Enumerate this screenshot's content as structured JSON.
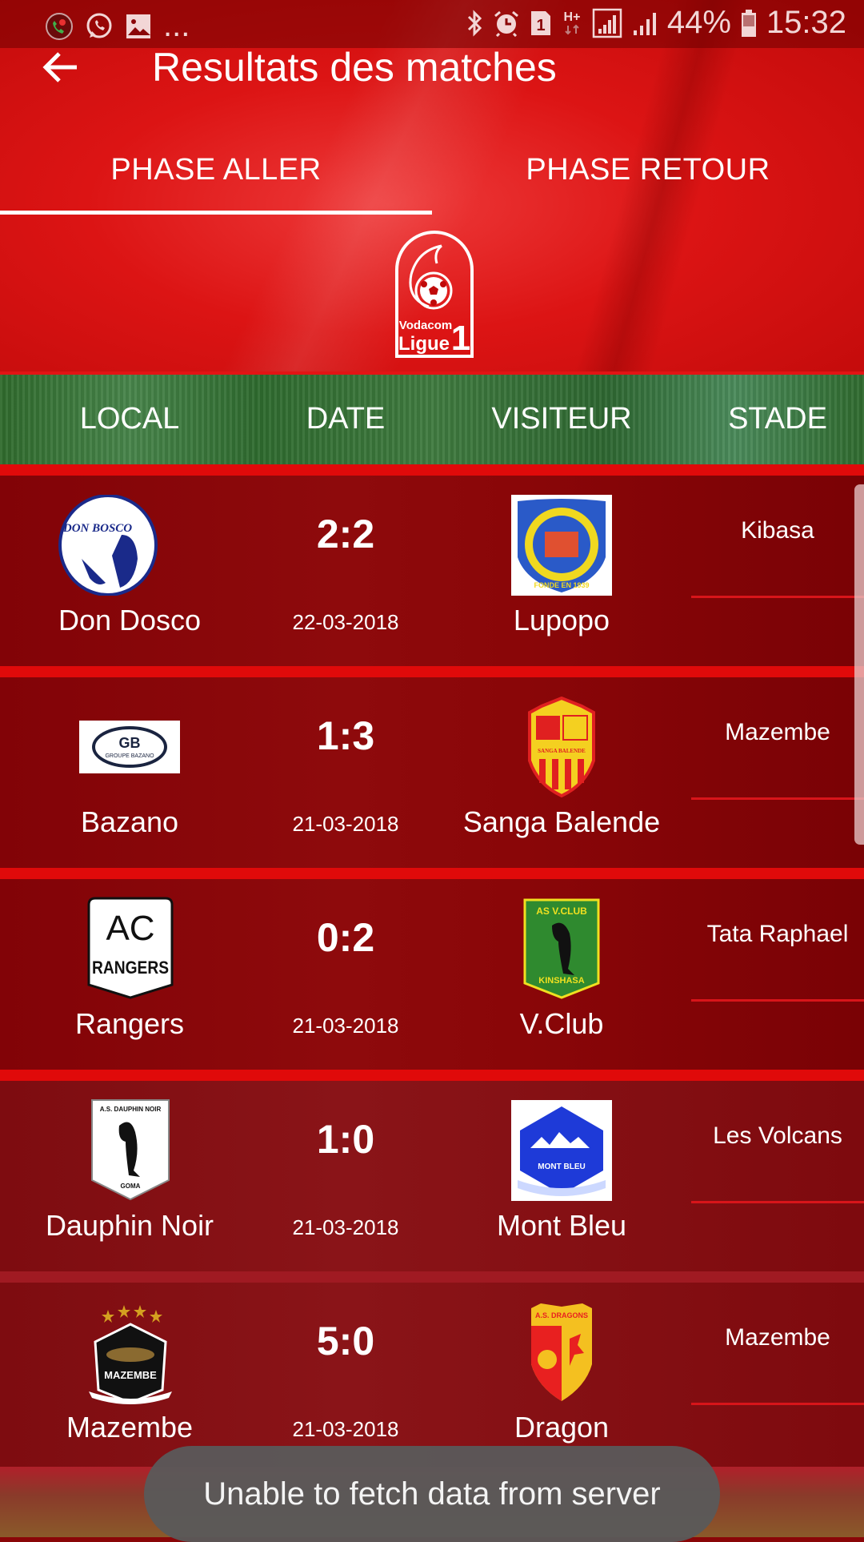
{
  "status_bar": {
    "notification_icons": [
      "call-recorder-icon",
      "whatsapp-icon",
      "gallery-icon",
      "more-notifications-icon"
    ],
    "more_label": "...",
    "system_icons": [
      "bluetooth-icon",
      "alarm-icon",
      "sim-1-icon",
      "hplus-data-icon",
      "signal-sim1-icon",
      "signal-sim2-icon"
    ],
    "sim_label": "1",
    "network_label": "H+",
    "battery": "44%",
    "time": "15:32"
  },
  "toolbar": {
    "back_icon": "arrow-left-icon",
    "title": "Resultats des matches"
  },
  "tabs": [
    {
      "label": "PHASE ALLER",
      "active": true
    },
    {
      "label": "PHASE RETOUR",
      "active": false
    }
  ],
  "logo": {
    "line1": "Vodacom",
    "line2": "Ligue",
    "number": "1"
  },
  "table": {
    "headers": [
      "LOCAL",
      "DATE",
      "VISITEUR",
      "STADE"
    ],
    "rows": [
      {
        "home": "Don Dosco",
        "home_badge": "don-bosco-badge",
        "score": "2:2",
        "date": "22-03-2018",
        "away": "Lupopo",
        "away_badge": "lupopo-badge",
        "stadium": "Kibasa"
      },
      {
        "home": "Bazano",
        "home_badge": "bazano-badge",
        "score": "1:3",
        "date": "21-03-2018",
        "away": "Sanga Balende",
        "away_badge": "sanga-balende-badge",
        "stadium": "Mazembe"
      },
      {
        "home": "Rangers",
        "home_badge": "rangers-badge",
        "score": "0:2",
        "date": "21-03-2018",
        "away": "V.Club",
        "away_badge": "vclub-badge",
        "stadium": "Tata Raphael"
      },
      {
        "home": "Dauphin Noir",
        "home_badge": "dauphin-noir-badge",
        "score": "1:0",
        "date": "21-03-2018",
        "away": "Mont Bleu",
        "away_badge": "mont-bleu-badge",
        "stadium": "Les Volcans"
      },
      {
        "home": "Mazembe",
        "home_badge": "mazembe-badge",
        "score": "5:0",
        "date": "21-03-2018",
        "away": "Dragon",
        "away_badge": "dragons-badge",
        "stadium": "Mazembe"
      }
    ]
  },
  "badges": {
    "bazano_text": "GB",
    "bazano_sub": "GROUPE BAZANO",
    "rangers_top": "AC",
    "rangers_bottom": "RANGERS",
    "vclub_top": "AS V.CLUB",
    "vclub_bottom": "KINSHASA",
    "dauphin_top": "A.S. DAUPHIN NOIR",
    "dauphin_bottom": "GOMA",
    "montbleu_text": "MONT BLEU",
    "mazembe_text": "MAZEMBE",
    "dragons_text": "A.S. DRAGONS",
    "sanga_text": "SANGA BALENDE",
    "lupopo_text": "FONDE EN 1939",
    "donbosco_text": "DON BOSCO"
  },
  "toast": {
    "message": "Unable to fetch data from server"
  },
  "colors": {
    "primary_red": "#dc1414",
    "row_dark_red": "#8a0608",
    "separator_red": "#e00a0a",
    "toast_bg": "#5a5a5a"
  }
}
